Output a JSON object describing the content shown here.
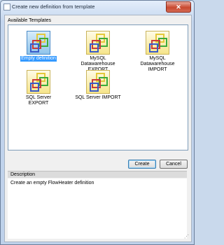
{
  "window": {
    "title": "Create new definition from template"
  },
  "templates_group": {
    "label": "Available Templates"
  },
  "templates": [
    {
      "label": "Empty definition"
    },
    {
      "label": "MySQL Datawarehouse EXPORT"
    },
    {
      "label": "MySQL Datawarehouse IMPORT"
    },
    {
      "label": "SQL Server EXPORT"
    },
    {
      "label": "SQL Server IMPORT"
    }
  ],
  "buttons": {
    "create": "Create",
    "cancel": "Cancel"
  },
  "description": {
    "header": "Description",
    "text": "Create an empty FlowHeater definition"
  },
  "icons": {
    "close": "close-icon",
    "template": "template-icon"
  }
}
